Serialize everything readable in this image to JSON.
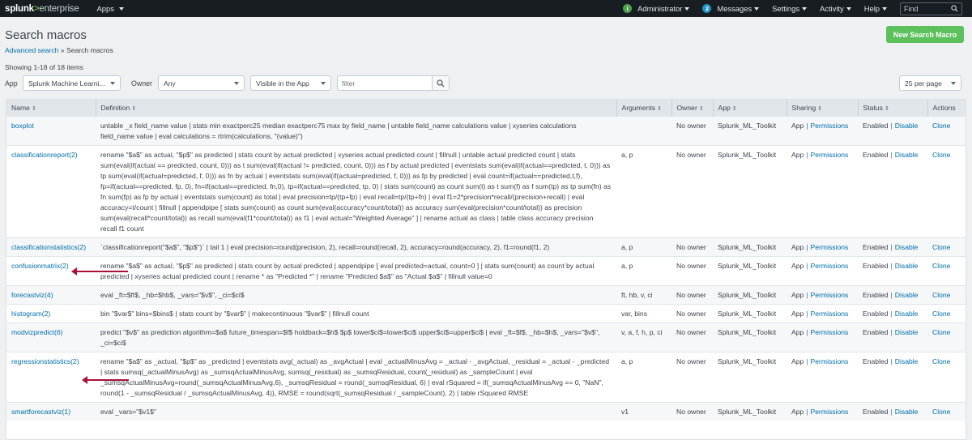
{
  "topbar": {
    "logo_main": "splunk",
    "logo_gt": ">",
    "logo_suffix": "enterprise",
    "apps_label": "Apps",
    "user_label": "Administrator",
    "messages_count": "2",
    "messages_label": "Messages",
    "settings_label": "Settings",
    "activity_label": "Activity",
    "help_label": "Help",
    "find_placeholder": "Find"
  },
  "header": {
    "title": "Search macros",
    "breadcrumb_link": "Advanced search",
    "breadcrumb_sep": "»",
    "breadcrumb_current": "Search macros",
    "new_button": "New Search Macro",
    "showing": "Showing 1-18 of 18 items"
  },
  "filters": {
    "app_label": "App",
    "app_value": "Splunk Machine Learni...",
    "owner_label": "Owner",
    "owner_value": "Any",
    "visibility_value": "Visible in the App",
    "filter_placeholder": "filter",
    "per_page_value": "25 per page"
  },
  "table": {
    "columns": {
      "name": "Name",
      "definition": "Definition",
      "arguments": "Arguments",
      "owner": "Owner",
      "app": "App",
      "sharing": "Sharing",
      "status": "Status",
      "actions": "Actions"
    },
    "sort_glyph": "⇕",
    "sharing_app": "App",
    "permissions": "Permissions",
    "enabled": "Enabled",
    "disable": "Disable",
    "clone": "Clone",
    "pipe": "|",
    "rows": [
      {
        "name": "boxplot",
        "definition": "untable _x field_name value | stats min exactperc25 median exactperc75 max by field_name | untable field_name calculations value | xyseries calculations field_name value | eval calculations = rtrim(calculations, \"(value)\")",
        "arguments": "",
        "owner": "No owner",
        "app": "Splunk_ML_Toolkit"
      },
      {
        "name": "classificationreport(2)",
        "definition": "rename \"$a$\" as actual, \"$p$\" as predicted | stats count by actual predicted | xyseries actual predicted count | fillnull | untable actual predicted count | stats sum(eval(if(actual == predicted, count, 0))) as t sum(eval(if(actual != predicted, count, 0))) as f by actual predicted | eventstats sum(eval(if(actual==predicted, t, 0))) as tp sum(eval(if(actual=predicted, f, 0))) as fn by actual | eventstats sum(eval(if(actual=predicted, f, 0))) as fp by predicted | eval count=if(actual==predicted,t,f), fp=if(actual==predicted, fp, 0), fn=if(actual==predicted, fn,0), tp=if(actual==predicted, tp, 0) | stats sum(count) as count sum(t) as t sum(f) as f sum(tp) as tp sum(fn) as fn sum(fp) as fp by actual | eventstats sum(count) as total | eval precision=tp/(tp+fp) | eval recall=tp/(tp+fn) | eval f1=2*precision*recall/(precision+recall) | eval accuracy=t/count | fillnull | appendpipe [ stats sum(count) as count sum(eval(accuracy*count/total)) as accuracy sum(eval(precision*count/total)) as precision sum(eval(recall*count/total)) as recall sum(eval(f1*count/total)) as f1 | eval actual=\"Weighted Average\" ] | rename actual as class | table class accuracy precision recall f1 count",
        "arguments": "a, p",
        "owner": "No owner",
        "app": "Splunk_ML_Toolkit"
      },
      {
        "name": "classificationstatistics(2)",
        "definition": "`classificationreport(\"$a$\", \"$p$\")` | tail 1 | eval precision=round(precision, 2), recall=round(recall, 2), accuracy=round(accuracy, 2), f1=round(f1, 2)",
        "arguments": "a, p",
        "owner": "No owner",
        "app": "Splunk_ML_Toolkit"
      },
      {
        "name": "confusionmatrix(2)",
        "definition": "rename \"$a$\" as actual, \"$p$\" as predicted | stats count by actual predicted | appendpipe [ eval predicted=actual, count=0 ] | stats sum(count) as count by actual predicted | xyseries actual predicted count | rename * as \"Predicted *\" | rename \"Predicted $a$\" as \"Actual $a$\" | fillnull value=0",
        "arguments": "a, p",
        "owner": "No owner",
        "app": "Splunk_ML_Toolkit"
      },
      {
        "name": "forecastviz(4)",
        "definition": "eval _ft=$ft$, _hb=$hb$, _vars=\"$v$\", _ci=$ci$",
        "arguments": "ft, hb, v, ci",
        "owner": "No owner",
        "app": "Splunk_ML_Toolkit"
      },
      {
        "name": "histogram(2)",
        "definition": "bin \"$var$\" bins=$bins$ | stats count by \"$var$\" | makecontinuous \"$var$\" | fillnull count",
        "arguments": "var, bins",
        "owner": "No owner",
        "app": "Splunk_ML_Toolkit"
      },
      {
        "name": "modvizpredict(6)",
        "definition": "predict \"$v$\" as prediction algorithm=$a$ future_timespan=$f$ holdback=$h$ $p$ lower$ci$=lower$ci$ upper$ci$=upper$ci$ | eval _ft=$f$, _hb=$h$, _vars=\"$v$\", _ci=$ci$",
        "arguments": "v, a, f, h, p, ci",
        "owner": "No owner",
        "app": "Splunk_ML_Toolkit"
      },
      {
        "name": "regressionstatistics(2)",
        "definition": "rename \"$a$\" as _actual, \"$p$\" as _predicted | eventstats avg(_actual) as _avgActual | eval _actualMinusAvg = _actual - _avgActual, _residual = _actual - _predicted | stats sumsq(_actualMinusAvg) as _sumsqActualMinusAvg, sumsq(_residual) as _sumsqResidual, count(_residual) as _sampleCount | eval _sumsqActualMinusAvg=round(_sumsqActualMinusAvg,6), _sumsqResidual = round(_sumsqResidual, 6) | eval rSquared = if(_sumsqActualMinusAvg == 0, \"NaN\", round(1 - _sumsqResidual / _sumsqActualMinusAvg, 4)), RMSE = round(sqrt(_sumsqResidual / _sampleCount), 2) | table rSquared RMSE",
        "arguments": "a, p",
        "owner": "No owner",
        "app": "Splunk_ML_Toolkit"
      },
      {
        "name": "smartforecastviz(1)",
        "definition": "eval _vars=\"$v1$\"",
        "arguments": "v1",
        "owner": "No owner",
        "app": "Splunk_ML_Toolkit"
      }
    ]
  },
  "colors": {
    "topbar": "#171d21",
    "link": "#006eaa",
    "new_button": "#5cc05c",
    "annotation_arrow": "#a8123a"
  }
}
